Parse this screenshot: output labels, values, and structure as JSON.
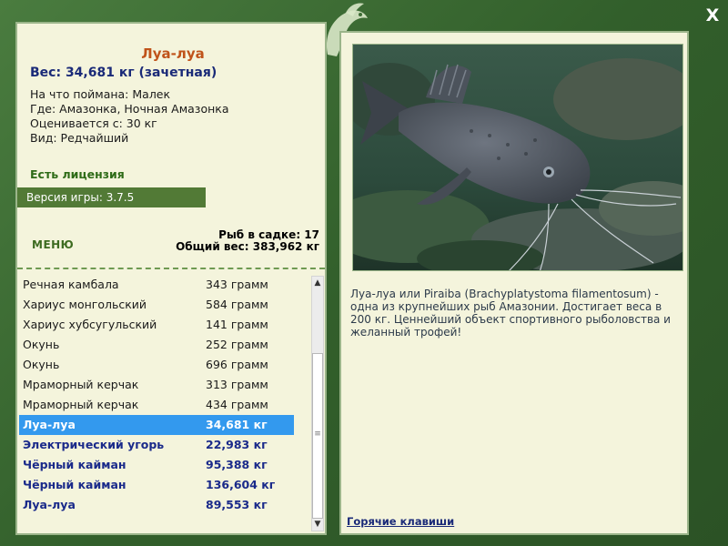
{
  "window": {
    "close_label": "X"
  },
  "fish": {
    "title": "Луа-луа",
    "weight_line": "Вес: 34,681 кг (зачетная)",
    "caught_on": "На что поймана: Малек",
    "location": "Где: Амазонка, Ночная Амазонка",
    "rated_from": "Оценивается с: 30 кг",
    "kind": "Вид: Редчайший",
    "license": "Есть лицензия",
    "description": "Луа-луа или Piraiba (Brachyplatystoma filamentosum) - одна из крупнейших рыб Амазонии. Достигает веса в 200 кг. Ценнейший объект спортивного рыболовства и желанный трофей!",
    "image": "catfish-photo"
  },
  "game": {
    "version": "Версия игры: 3.7.5",
    "menu_label": "МЕНЮ",
    "hotkeys_label": "Горячие клавиши"
  },
  "stats": {
    "fish_in_keepnet": "Рыб в садке: 17",
    "total_weight": "Общий вес: 383,962 кг"
  },
  "catch_list": [
    {
      "name": "Речная камбала",
      "weight": "343 грамм",
      "trophy": false,
      "selected": false
    },
    {
      "name": "Хариус монгольский",
      "weight": "584 грамм",
      "trophy": false,
      "selected": false
    },
    {
      "name": "Хариус хубсугульский",
      "weight": "141 грамм",
      "trophy": false,
      "selected": false
    },
    {
      "name": "Окунь",
      "weight": "252 грамм",
      "trophy": false,
      "selected": false
    },
    {
      "name": "Окунь",
      "weight": "696 грамм",
      "trophy": false,
      "selected": false
    },
    {
      "name": "Мраморный керчак",
      "weight": "313 грамм",
      "trophy": false,
      "selected": false
    },
    {
      "name": "Мраморный керчак",
      "weight": "434 грамм",
      "trophy": false,
      "selected": false
    },
    {
      "name": "Луа-луа",
      "weight": "34,681 кг",
      "trophy": true,
      "selected": true
    },
    {
      "name": "Электрический угорь",
      "weight": "22,983 кг",
      "trophy": true,
      "selected": false
    },
    {
      "name": "Чёрный кайман",
      "weight": "95,388 кг",
      "trophy": true,
      "selected": false
    },
    {
      "name": "Чёрный кайман",
      "weight": "136,604 кг",
      "trophy": true,
      "selected": false
    },
    {
      "name": "Луа-луа",
      "weight": "89,553 кг",
      "trophy": true,
      "selected": false
    }
  ],
  "scrollbar": {
    "up_icon": "arrow-up-icon",
    "down_icon": "arrow-down-icon",
    "grip_icon": "grip-icon"
  },
  "colors": {
    "frame": "#3d6b34",
    "panel": "#f4f4dc",
    "title": "#c0531a",
    "trophy_text": "#1a2a8a",
    "license": "#2e6b17",
    "selection": "#3399ee"
  }
}
